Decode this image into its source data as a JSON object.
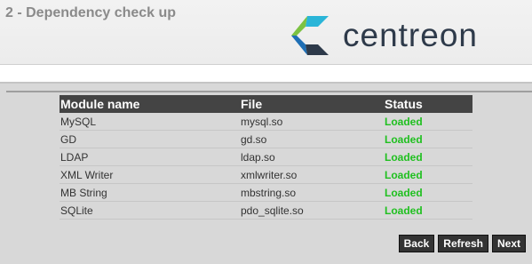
{
  "header": {
    "title": "2 - Dependency check up",
    "logo_text": "centreon"
  },
  "table": {
    "columns": [
      "Module name",
      "File",
      "Status"
    ],
    "rows": [
      {
        "name": "MySQL",
        "file": "mysql.so",
        "status": "Loaded"
      },
      {
        "name": "GD",
        "file": "gd.so",
        "status": "Loaded"
      },
      {
        "name": "LDAP",
        "file": "ldap.so",
        "status": "Loaded"
      },
      {
        "name": "XML Writer",
        "file": "xmlwriter.so",
        "status": "Loaded"
      },
      {
        "name": "MB String",
        "file": "mbstring.so",
        "status": "Loaded"
      },
      {
        "name": "SQLite",
        "file": "pdo_sqlite.so",
        "status": "Loaded"
      }
    ]
  },
  "buttons": {
    "back": "Back",
    "refresh": "Refresh",
    "next": "Next"
  },
  "colors": {
    "status_loaded": "#20c020",
    "table_header_bg": "#444444",
    "logo_text": "#2e3a4a",
    "logo_mark": [
      "#2ab5d8",
      "#7cc242",
      "#1f6fb5",
      "#2e3a4a"
    ]
  }
}
